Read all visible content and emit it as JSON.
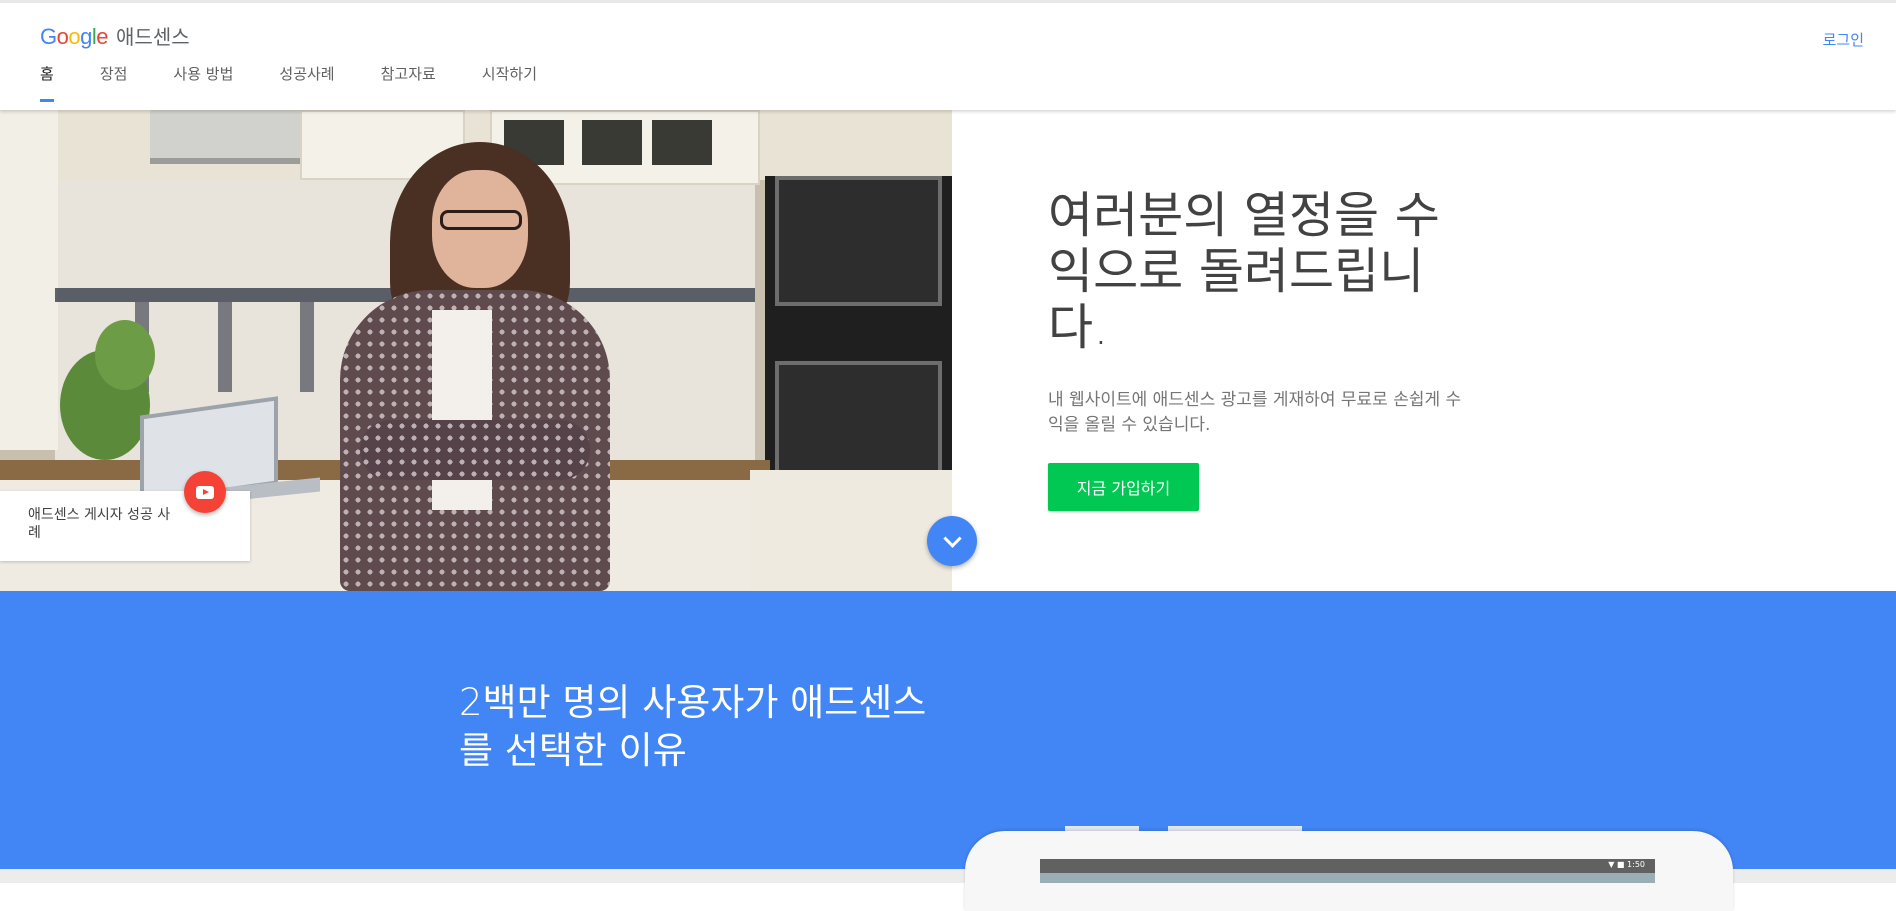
{
  "header": {
    "product": "애드센스",
    "login_label": "로그인"
  },
  "nav": {
    "items": [
      {
        "label": "홈",
        "active": true
      },
      {
        "label": "장점"
      },
      {
        "label": "사용 방법"
      },
      {
        "label": "성공사례"
      },
      {
        "label": "참고자료"
      },
      {
        "label": "시작하기"
      }
    ]
  },
  "hero": {
    "title": "여러분의 열정을 수익으로 돌려드립니다.",
    "subtitle": "내 웹사이트에 애드센스 광고를 게재하여 무료로 손쉽게 수익을 올릴 수 있습니다.",
    "cta_label": "지금 가입하기",
    "story_card_label": "애드센스 게시자 성공 사례"
  },
  "why_section": {
    "title": "2백만 명의 사용자가 애드센스를 선택한 이유"
  },
  "device": {
    "status_text": "▼ ■ 1:50"
  },
  "colors": {
    "accent": "#4285f4",
    "cta": "#00c853",
    "youtube": "#f44336"
  },
  "icons": [
    "youtube-play-icon",
    "chevron-down-icon"
  ]
}
